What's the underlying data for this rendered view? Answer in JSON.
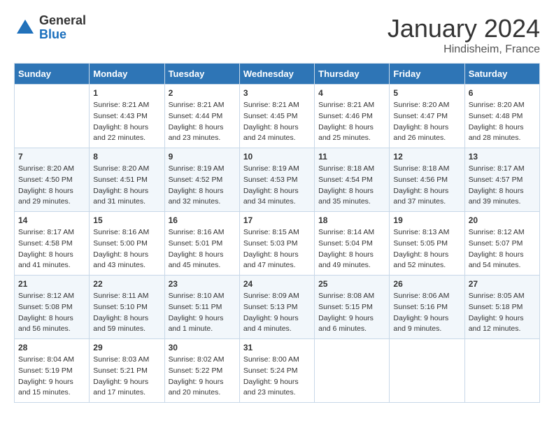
{
  "header": {
    "logo": {
      "line1": "General",
      "line2": "Blue"
    },
    "title": "January 2024",
    "subtitle": "Hindisheim, France"
  },
  "weekdays": [
    "Sunday",
    "Monday",
    "Tuesday",
    "Wednesday",
    "Thursday",
    "Friday",
    "Saturday"
  ],
  "weeks": [
    [
      {
        "day": "",
        "sunrise": "",
        "sunset": "",
        "daylight": ""
      },
      {
        "day": "1",
        "sunrise": "Sunrise: 8:21 AM",
        "sunset": "Sunset: 4:43 PM",
        "daylight": "Daylight: 8 hours and 22 minutes."
      },
      {
        "day": "2",
        "sunrise": "Sunrise: 8:21 AM",
        "sunset": "Sunset: 4:44 PM",
        "daylight": "Daylight: 8 hours and 23 minutes."
      },
      {
        "day": "3",
        "sunrise": "Sunrise: 8:21 AM",
        "sunset": "Sunset: 4:45 PM",
        "daylight": "Daylight: 8 hours and 24 minutes."
      },
      {
        "day": "4",
        "sunrise": "Sunrise: 8:21 AM",
        "sunset": "Sunset: 4:46 PM",
        "daylight": "Daylight: 8 hours and 25 minutes."
      },
      {
        "day": "5",
        "sunrise": "Sunrise: 8:20 AM",
        "sunset": "Sunset: 4:47 PM",
        "daylight": "Daylight: 8 hours and 26 minutes."
      },
      {
        "day": "6",
        "sunrise": "Sunrise: 8:20 AM",
        "sunset": "Sunset: 4:48 PM",
        "daylight": "Daylight: 8 hours and 28 minutes."
      }
    ],
    [
      {
        "day": "7",
        "sunrise": "Sunrise: 8:20 AM",
        "sunset": "Sunset: 4:50 PM",
        "daylight": "Daylight: 8 hours and 29 minutes."
      },
      {
        "day": "8",
        "sunrise": "Sunrise: 8:20 AM",
        "sunset": "Sunset: 4:51 PM",
        "daylight": "Daylight: 8 hours and 31 minutes."
      },
      {
        "day": "9",
        "sunrise": "Sunrise: 8:19 AM",
        "sunset": "Sunset: 4:52 PM",
        "daylight": "Daylight: 8 hours and 32 minutes."
      },
      {
        "day": "10",
        "sunrise": "Sunrise: 8:19 AM",
        "sunset": "Sunset: 4:53 PM",
        "daylight": "Daylight: 8 hours and 34 minutes."
      },
      {
        "day": "11",
        "sunrise": "Sunrise: 8:18 AM",
        "sunset": "Sunset: 4:54 PM",
        "daylight": "Daylight: 8 hours and 35 minutes."
      },
      {
        "day": "12",
        "sunrise": "Sunrise: 8:18 AM",
        "sunset": "Sunset: 4:56 PM",
        "daylight": "Daylight: 8 hours and 37 minutes."
      },
      {
        "day": "13",
        "sunrise": "Sunrise: 8:17 AM",
        "sunset": "Sunset: 4:57 PM",
        "daylight": "Daylight: 8 hours and 39 minutes."
      }
    ],
    [
      {
        "day": "14",
        "sunrise": "Sunrise: 8:17 AM",
        "sunset": "Sunset: 4:58 PM",
        "daylight": "Daylight: 8 hours and 41 minutes."
      },
      {
        "day": "15",
        "sunrise": "Sunrise: 8:16 AM",
        "sunset": "Sunset: 5:00 PM",
        "daylight": "Daylight: 8 hours and 43 minutes."
      },
      {
        "day": "16",
        "sunrise": "Sunrise: 8:16 AM",
        "sunset": "Sunset: 5:01 PM",
        "daylight": "Daylight: 8 hours and 45 minutes."
      },
      {
        "day": "17",
        "sunrise": "Sunrise: 8:15 AM",
        "sunset": "Sunset: 5:03 PM",
        "daylight": "Daylight: 8 hours and 47 minutes."
      },
      {
        "day": "18",
        "sunrise": "Sunrise: 8:14 AM",
        "sunset": "Sunset: 5:04 PM",
        "daylight": "Daylight: 8 hours and 49 minutes."
      },
      {
        "day": "19",
        "sunrise": "Sunrise: 8:13 AM",
        "sunset": "Sunset: 5:05 PM",
        "daylight": "Daylight: 8 hours and 52 minutes."
      },
      {
        "day": "20",
        "sunrise": "Sunrise: 8:12 AM",
        "sunset": "Sunset: 5:07 PM",
        "daylight": "Daylight: 8 hours and 54 minutes."
      }
    ],
    [
      {
        "day": "21",
        "sunrise": "Sunrise: 8:12 AM",
        "sunset": "Sunset: 5:08 PM",
        "daylight": "Daylight: 8 hours and 56 minutes."
      },
      {
        "day": "22",
        "sunrise": "Sunrise: 8:11 AM",
        "sunset": "Sunset: 5:10 PM",
        "daylight": "Daylight: 8 hours and 59 minutes."
      },
      {
        "day": "23",
        "sunrise": "Sunrise: 8:10 AM",
        "sunset": "Sunset: 5:11 PM",
        "daylight": "Daylight: 9 hours and 1 minute."
      },
      {
        "day": "24",
        "sunrise": "Sunrise: 8:09 AM",
        "sunset": "Sunset: 5:13 PM",
        "daylight": "Daylight: 9 hours and 4 minutes."
      },
      {
        "day": "25",
        "sunrise": "Sunrise: 8:08 AM",
        "sunset": "Sunset: 5:15 PM",
        "daylight": "Daylight: 9 hours and 6 minutes."
      },
      {
        "day": "26",
        "sunrise": "Sunrise: 8:06 AM",
        "sunset": "Sunset: 5:16 PM",
        "daylight": "Daylight: 9 hours and 9 minutes."
      },
      {
        "day": "27",
        "sunrise": "Sunrise: 8:05 AM",
        "sunset": "Sunset: 5:18 PM",
        "daylight": "Daylight: 9 hours and 12 minutes."
      }
    ],
    [
      {
        "day": "28",
        "sunrise": "Sunrise: 8:04 AM",
        "sunset": "Sunset: 5:19 PM",
        "daylight": "Daylight: 9 hours and 15 minutes."
      },
      {
        "day": "29",
        "sunrise": "Sunrise: 8:03 AM",
        "sunset": "Sunset: 5:21 PM",
        "daylight": "Daylight: 9 hours and 17 minutes."
      },
      {
        "day": "30",
        "sunrise": "Sunrise: 8:02 AM",
        "sunset": "Sunset: 5:22 PM",
        "daylight": "Daylight: 9 hours and 20 minutes."
      },
      {
        "day": "31",
        "sunrise": "Sunrise: 8:00 AM",
        "sunset": "Sunset: 5:24 PM",
        "daylight": "Daylight: 9 hours and 23 minutes."
      },
      {
        "day": "",
        "sunrise": "",
        "sunset": "",
        "daylight": ""
      },
      {
        "day": "",
        "sunrise": "",
        "sunset": "",
        "daylight": ""
      },
      {
        "day": "",
        "sunrise": "",
        "sunset": "",
        "daylight": ""
      }
    ]
  ]
}
